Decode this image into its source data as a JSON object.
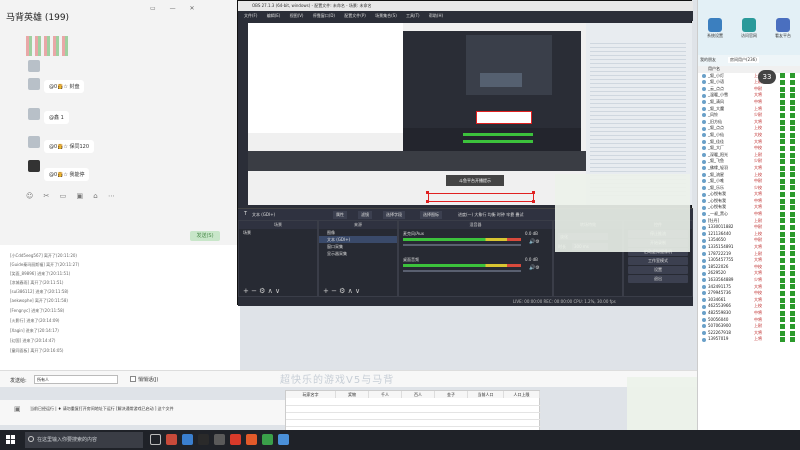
{
  "chat": {
    "title": "马背英雄 (199)",
    "messages": [
      {
        "text": "@0👸☆ 封盘"
      },
      {
        "text": "@鑫 1"
      },
      {
        "text": "@0👸☆ 保同120"
      },
      {
        "text": "@0👸☆ 我能停"
      }
    ],
    "send_label": "发送(S)"
  },
  "log": {
    "lines": [
      "[小Cdd5eeg567] 离开了(20:11:20)",
      "[Guide秦玛丽斯福] 离开了(20:11:27)",
      "[笑面_89896] 进来了(20:11:51)",
      "[凉城春雨] 离开了(20:11:51)",
      "[sul386112] 进来了(20:11:58)",
      "[aekwophe] 离开了(20:11:58)",
      "[Fengnyc] 进来了(20:11:58)",
      "[火影行] 进来了(20:14:09)",
      "[Xagin] 进来了(20:14:17)",
      "[幻国] 进来了(20:14:47)",
      "[童同面板] 离开了(20:16:05)"
    ]
  },
  "lowbar": {
    "send_to_label": "发送给:",
    "send_to_value": "所有人",
    "private_label": "悄悄话(J)"
  },
  "statusbar": {
    "text": "当前已经运行 | ♦ 请勿重复打开房间地址下运行 [解决通常游戏已启动 ] 这个文件"
  },
  "obs": {
    "title": "OBS 27.1.3 (64-bit, windows) - 配置文件: 未命名 - 场景: 未命名",
    "menu": [
      "文件(F)",
      "编辑(E)",
      "视图(V)",
      "停靠窗口(D)",
      "配置文件(P)",
      "场景集合(S)",
      "工具(T)",
      "帮助(H)"
    ],
    "preview_button": "斗鱼平台开播提示",
    "source_toolbar": [
      "属性",
      "滤镜",
      "选择字段",
      "选择图标",
      "进度(一) 大象行 均衡 时钟 牢靠 叠试"
    ],
    "source_label": "文本 (GDI+)",
    "docks": {
      "scenes": "场景",
      "sources": "来源",
      "mixer": "混音器",
      "transitions": "转场特效",
      "controls": "控件"
    },
    "scene_item": "场景",
    "sources": [
      "图像",
      "文本 (GDI+)",
      "窗口采集",
      "显示器采集"
    ],
    "mixer_tracks": [
      {
        "name": "麦克风/Aux",
        "db": "0.0 dB"
      },
      {
        "name": "桌面音频",
        "db": "0.0 dB"
      }
    ],
    "transition": {
      "type": "淡化",
      "duration_label": "时长",
      "duration": "300 ms"
    },
    "controls": [
      "停止推流",
      "开始录制",
      "启动虚拟摄像机",
      "工作室模式",
      "设置",
      "退出"
    ],
    "status": "LIVE: 00:00:00   REC: 00:00:00   CPU: 1.2%, 30.00 fps"
  },
  "rightpanel": {
    "buttons": [
      "系统设置",
      "访问官网",
      "看友平台"
    ],
    "tabs": [
      "我的朋友",
      "房间用户(236)"
    ],
    "header": "用户名",
    "count_badge": "33",
    "users": [
      {
        "name": "_叙_小灯",
        "status": "上尉"
      },
      {
        "name": "_叙_小语",
        "status": "上尉"
      },
      {
        "name": "_云_点点",
        "status": "中尉"
      },
      {
        "name": "_温暖_小雪",
        "status": "大将"
      },
      {
        "name": "_叙_清风",
        "status": "中将"
      },
      {
        "name": "_叙_大魔",
        "status": "上将"
      },
      {
        "name": "_风铃",
        "status": "少尉"
      },
      {
        "name": "_旧方仙",
        "status": "大将"
      },
      {
        "name": "_叙_点点",
        "status": "上校"
      },
      {
        "name": "_叙_小仙",
        "status": "大校"
      },
      {
        "name": "_叙_佳佳",
        "status": "大将"
      },
      {
        "name": "_叙_大厂",
        "status": "中校"
      },
      {
        "name": "_深暖_阳光",
        "status": "上尉"
      },
      {
        "name": "_叙_飞鱼",
        "status": "少尉"
      },
      {
        "name": "_佛缘_轻羽",
        "status": "大将"
      },
      {
        "name": "_叙_流星",
        "status": "上校"
      },
      {
        "name": "_叙_小唯",
        "status": "中尉"
      },
      {
        "name": "_叙_乐乐",
        "status": "少校"
      },
      {
        "name": "_心悦有我",
        "status": "大将"
      },
      {
        "name": "_心悦有我",
        "status": "中将"
      },
      {
        "name": "_心悦有我",
        "status": "大将"
      },
      {
        "name": "_一叔_黑心",
        "status": "中将"
      },
      {
        "name": "[牡丹]",
        "status": "上尉"
      },
      {
        "name": "1330011882",
        "status": "中尉"
      },
      {
        "name": "121136440",
        "status": "上校"
      },
      {
        "name": "1354650",
        "status": "中尉"
      },
      {
        "name": "1335154891",
        "status": "大将"
      },
      {
        "name": "178722219",
        "status": "上尉"
      },
      {
        "name": "1305457755",
        "status": "大将"
      },
      {
        "name": "18522026",
        "status": "中校"
      },
      {
        "name": "2629520",
        "status": "大将"
      },
      {
        "name": "1633564889",
        "status": "少将"
      },
      {
        "name": "342491175",
        "status": "大将"
      },
      {
        "name": "279945736",
        "status": "中校"
      },
      {
        "name": "3034661",
        "status": "大将"
      },
      {
        "name": "462553966",
        "status": "上校"
      },
      {
        "name": "482559830",
        "status": "中将"
      },
      {
        "name": "50056040",
        "status": "中将"
      },
      {
        "name": "507063900",
        "status": "上尉"
      },
      {
        "name": "522267918",
        "status": "大将"
      },
      {
        "name": "13957019",
        "status": "上将"
      }
    ]
  },
  "grid": {
    "headers": [
      "玩家名字",
      "奖物",
      "千人",
      "百人",
      "金子",
      "当前人口",
      "人口上限"
    ]
  },
  "watermark": "超快乐的游戏V5与马背",
  "taskbar": {
    "search_placeholder": "在这里输入你要搜索的内容"
  },
  "colors": {
    "obs_bg": "#2b2e38",
    "preview_red": "#e02020",
    "meter_green": "#3cc23c",
    "user_green": "#2c9a2c",
    "taskbar": "#1f2228"
  }
}
